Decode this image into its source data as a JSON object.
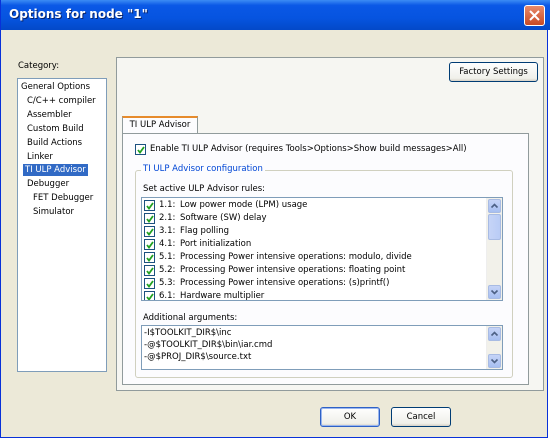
{
  "window": {
    "title": "Options for node \"1\""
  },
  "category": {
    "label": "Category:",
    "items": [
      {
        "label": "General Options"
      },
      {
        "label": "C/C++ compiler"
      },
      {
        "label": "Assembler"
      },
      {
        "label": "Custom Build"
      },
      {
        "label": "Build Actions"
      },
      {
        "label": "Linker"
      },
      {
        "label": "TI ULP Advisor"
      },
      {
        "label": "Debugger"
      },
      {
        "label": "FET Debugger"
      },
      {
        "label": "Simulator"
      }
    ]
  },
  "panel": {
    "factory_button": "Factory Settings",
    "tab_label": "TI ULP Advisor",
    "enable_label": "Enable TI ULP Advisor (requires Tools>Options>Show build messages>All)",
    "group_title": "TI ULP Advisor configuration",
    "rules_label": "Set active ULP Advisor rules:",
    "rules": [
      {
        "id": "1.1:",
        "text": "Low power mode (LPM) usage"
      },
      {
        "id": "2.1:",
        "text": "Software (SW) delay"
      },
      {
        "id": "3.1:",
        "text": "Flag polling"
      },
      {
        "id": "4.1:",
        "text": "Port initialization"
      },
      {
        "id": "5.1:",
        "text": "Processing Power intensive operations: modulo, divide"
      },
      {
        "id": "5.2:",
        "text": "Processing Power intensive operations: floating point"
      },
      {
        "id": "5.3:",
        "text": "Processing Power intensive operations: (s)printf()"
      },
      {
        "id": "6.1:",
        "text": "Hardware multiplier"
      }
    ],
    "args_label": "Additional arguments:",
    "args": [
      "-I$TOOLKIT_DIR$\\inc",
      "-@$TOOLKIT_DIR$\\bin\\iar.cmd",
      "-@$PROJ_DIR$\\source.txt"
    ]
  },
  "footer": {
    "ok": "OK",
    "cancel": "Cancel"
  }
}
